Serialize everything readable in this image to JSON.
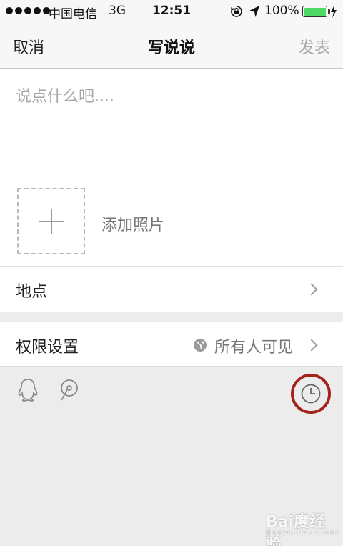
{
  "status_bar": {
    "carrier": "中国电信",
    "network": "3G",
    "time": "12:51",
    "battery_percent": "100%",
    "battery_color": "#4cd964",
    "icons": [
      "signal-dots",
      "rotation-lock-icon",
      "location-arrow-icon",
      "battery-icon",
      "charging-icon"
    ]
  },
  "nav": {
    "cancel_label": "取消",
    "title": "写说说",
    "publish_label": "发表"
  },
  "compose": {
    "placeholder": "说点什么吧....",
    "add_photo_label": "添加照片"
  },
  "location": {
    "label": "地点"
  },
  "permission": {
    "label": "权限设置",
    "value": "所有人可见"
  },
  "toolbar": {
    "icons": [
      "qq-icon",
      "mention-icon",
      "clock-icon"
    ],
    "highlight_color": "#a3231b"
  },
  "watermark": {
    "text": "Bai度经验",
    "sub": "jingyan.baidu.com"
  }
}
